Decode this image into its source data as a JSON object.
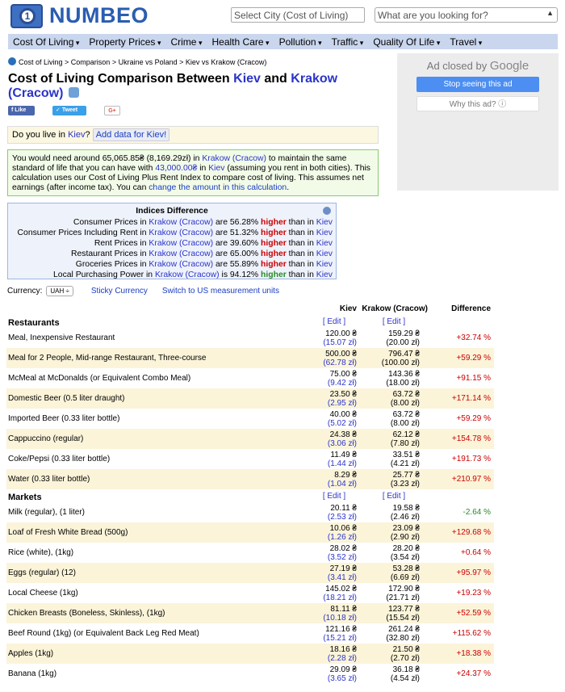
{
  "header": {
    "logo_text": "NUMBEO",
    "city_select_placeholder": "Select City (Cost of Living)",
    "search_placeholder": "What are you looking for?"
  },
  "nav": [
    {
      "label": "Cost Of Living"
    },
    {
      "label": "Property Prices"
    },
    {
      "label": "Crime"
    },
    {
      "label": "Health Care"
    },
    {
      "label": "Pollution"
    },
    {
      "label": "Traffic"
    },
    {
      "label": "Quality Of Life"
    },
    {
      "label": "Travel"
    }
  ],
  "breadcrumb": [
    "Cost of Living",
    "Comparison",
    "Ukraine vs Poland",
    "Kiev vs Krakow (Cracow)"
  ],
  "title": {
    "prefix": "Cost of Living Comparison Between ",
    "city1": "Kiev",
    "and": " and ",
    "city2": "Krakow (Cracow)"
  },
  "social": {
    "like": "Like",
    "tweet": "Tweet",
    "gplus": "G+"
  },
  "ad": {
    "closed_by": "Ad closed by ",
    "google": "Google",
    "stop": "Stop seeing this ad",
    "why": "Why this ad? ⓘ"
  },
  "live": {
    "q1": "Do you live in ",
    "city": "Kiev",
    "q2": "?",
    "add_button": "Add data for Kiev!"
  },
  "summary": {
    "t1": "You would need around 65,065.85₴ (8,169.29zł) in ",
    "city2": "Krakow (Cracow)",
    "t2": " to maintain the same standard of life that you can have with ",
    "amount": "43,000.00₴",
    "t3": " in ",
    "city1": "Kiev",
    "t4": " (assuming you rent in both cities). This calculation uses our Cost of Living Plus Rent Index to compare cost of living. This assumes net earnings (after income tax). You can ",
    "link": "change the amount in this calculation",
    "t5": "."
  },
  "indices": {
    "title": "Indices Difference",
    "rows": [
      {
        "label": "Consumer Prices in ",
        "city2": "Krakow (Cracow)",
        "mid": " are 56.28% ",
        "word": "higher",
        "tail": " than in ",
        "city1": "Kiev"
      },
      {
        "label": "Consumer Prices Including Rent in ",
        "city2": "Krakow (Cracow)",
        "mid": " are 51.32% ",
        "word": "higher",
        "tail": " than in ",
        "city1": "Kiev"
      },
      {
        "label": "Rent Prices in ",
        "city2": "Krakow (Cracow)",
        "mid": " are 39.60% ",
        "word": "higher",
        "tail": " than in ",
        "city1": "Kiev"
      },
      {
        "label": "Restaurant Prices in ",
        "city2": "Krakow (Cracow)",
        "mid": " are 65.00% ",
        "word": "higher",
        "tail": " than in ",
        "city1": "Kiev"
      },
      {
        "label": "Groceries Prices in ",
        "city2": "Krakow (Cracow)",
        "mid": " are 55.89% ",
        "word": "higher",
        "tail": " than in ",
        "city1": "Kiev"
      },
      {
        "label": "Local Purchasing Power in ",
        "city2": "Krakow (Cracow)",
        "mid": " is 94.12% ",
        "word": "higher",
        "tail": " than in ",
        "city1": "Kiev"
      }
    ]
  },
  "currency": {
    "label": "Currency:",
    "value": "UAH ÷",
    "sticky": "Sticky Currency",
    "units": "Switch to US measurement units"
  },
  "table": {
    "col_city1": "Kiev",
    "col_city2": "Krakow (Cracow)",
    "col_diff": "Difference",
    "edit": "[ Edit ]",
    "sections": [
      {
        "name": "Restaurants",
        "items": [
          {
            "name": "Meal, Inexpensive Restaurant",
            "v1": "120.00 ₴",
            "v1b": "(15.07 zł)",
            "v2": "159.29 ₴",
            "v2b": "(20.00 zł)",
            "diff": "+32.74 %"
          },
          {
            "name": "Meal for 2 People, Mid-range Restaurant, Three-course",
            "v1": "500.00 ₴",
            "v1b": "(62.78 zł)",
            "v2": "796.47 ₴",
            "v2b": "(100.00 zł)",
            "diff": "+59.29 %"
          },
          {
            "name": "McMeal at McDonalds (or Equivalent Combo Meal)",
            "v1": "75.00 ₴",
            "v1b": "(9.42 zł)",
            "v2": "143.36 ₴",
            "v2b": "(18.00 zł)",
            "diff": "+91.15 %"
          },
          {
            "name": "Domestic Beer (0.5 liter draught)",
            "v1": "23.50 ₴",
            "v1b": "(2.95 zł)",
            "v2": "63.72 ₴",
            "v2b": "(8.00 zł)",
            "diff": "+171.14 %"
          },
          {
            "name": "Imported Beer (0.33 liter bottle)",
            "v1": "40.00 ₴",
            "v1b": "(5.02 zł)",
            "v2": "63.72 ₴",
            "v2b": "(8.00 zł)",
            "diff": "+59.29 %"
          },
          {
            "name": "Cappuccino (regular)",
            "v1": "24.38 ₴",
            "v1b": "(3.06 zł)",
            "v2": "62.12 ₴",
            "v2b": "(7.80 zł)",
            "diff": "+154.78 %"
          },
          {
            "name": "Coke/Pepsi (0.33 liter bottle)",
            "v1": "11.49 ₴",
            "v1b": "(1.44 zł)",
            "v2": "33.51 ₴",
            "v2b": "(4.21 zł)",
            "diff": "+191.73 %"
          },
          {
            "name": "Water (0.33 liter bottle)",
            "v1": "8.29 ₴",
            "v1b": "(1.04 zł)",
            "v2": "25.77 ₴",
            "v2b": "(3.23 zł)",
            "diff": "+210.97 %"
          }
        ]
      },
      {
        "name": "Markets",
        "items": [
          {
            "name": "Milk (regular), (1 liter)",
            "v1": "20.11 ₴",
            "v1b": "(2.53 zł)",
            "v2": "19.58 ₴",
            "v2b": "(2.46 zł)",
            "diff": "-2.64 %"
          },
          {
            "name": "Loaf of Fresh White Bread (500g)",
            "v1": "10.06 ₴",
            "v1b": "(1.26 zł)",
            "v2": "23.09 ₴",
            "v2b": "(2.90 zł)",
            "diff": "+129.68 %"
          },
          {
            "name": "Rice (white), (1kg)",
            "v1": "28.02 ₴",
            "v1b": "(3.52 zł)",
            "v2": "28.20 ₴",
            "v2b": "(3.54 zł)",
            "diff": "+0.64 %"
          },
          {
            "name": "Eggs (regular) (12)",
            "v1": "27.19 ₴",
            "v1b": "(3.41 zł)",
            "v2": "53.28 ₴",
            "v2b": "(6.69 zł)",
            "diff": "+95.97 %"
          },
          {
            "name": "Local Cheese (1kg)",
            "v1": "145.02 ₴",
            "v1b": "(18.21 zł)",
            "v2": "172.90 ₴",
            "v2b": "(21.71 zł)",
            "diff": "+19.23 %"
          },
          {
            "name": "Chicken Breasts (Boneless, Skinless), (1kg)",
            "v1": "81.11 ₴",
            "v1b": "(10.18 zł)",
            "v2": "123.77 ₴",
            "v2b": "(15.54 zł)",
            "diff": "+52.59 %"
          },
          {
            "name": "Beef Round (1kg) (or Equivalent Back Leg Red Meat)",
            "v1": "121.16 ₴",
            "v1b": "(15.21 zł)",
            "v2": "261.24 ₴",
            "v2b": "(32.80 zł)",
            "diff": "+115.62 %"
          },
          {
            "name": "Apples (1kg)",
            "v1": "18.16 ₴",
            "v1b": "(2.28 zł)",
            "v2": "21.50 ₴",
            "v2b": "(2.70 zł)",
            "diff": "+18.38 %"
          },
          {
            "name": "Banana (1kg)",
            "v1": "29.09 ₴",
            "v1b": "(3.65 zł)",
            "v2": "36.18 ₴",
            "v2b": "(4.54 zł)",
            "diff": "+24.37 %"
          }
        ]
      }
    ]
  }
}
